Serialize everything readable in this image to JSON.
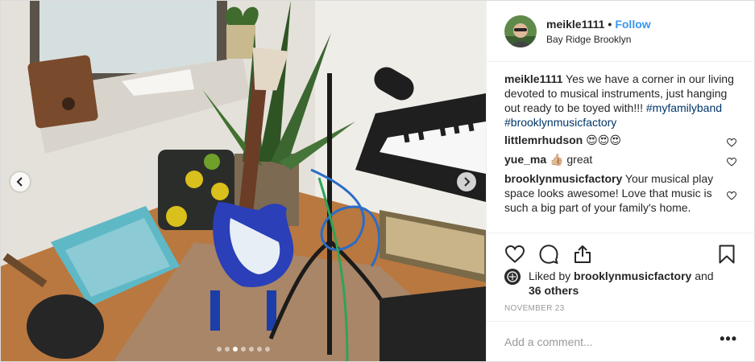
{
  "post": {
    "username": "meikle1111",
    "separator": "•",
    "follow_label": "Follow",
    "location": "Bay Ridge Brooklyn",
    "avatar_icon": "user-avatar"
  },
  "caption": {
    "username": "meikle1111",
    "text": " Yes we have a corner in our living devoted to musical instruments, just hanging out ready to be toyed with!!! ",
    "hashtags": [
      "#myfamilyband",
      "#brooklynmusicfactory"
    ]
  },
  "comments": [
    {
      "username": "littlemrhudson",
      "text": " 😍😍😍"
    },
    {
      "username": "yue_ma",
      "text": " 👍🏼 great"
    },
    {
      "username": "brooklynmusicfactory",
      "text": " Your musical play space looks awesome! Love that music is such a big part of your family's home."
    }
  ],
  "likes": {
    "prefix": "Liked by ",
    "user": "brooklynmusicfactory",
    "suffix": " and",
    "others": "36 others"
  },
  "date": "NOVEMBER 23",
  "add_comment_placeholder": "Add a comment...",
  "more_label": "•••",
  "carousel": {
    "count": 7,
    "active_index": 2
  },
  "colors": {
    "accent": "#3897f0",
    "hashtag": "#003569",
    "text": "#262626",
    "muted": "#999999"
  }
}
